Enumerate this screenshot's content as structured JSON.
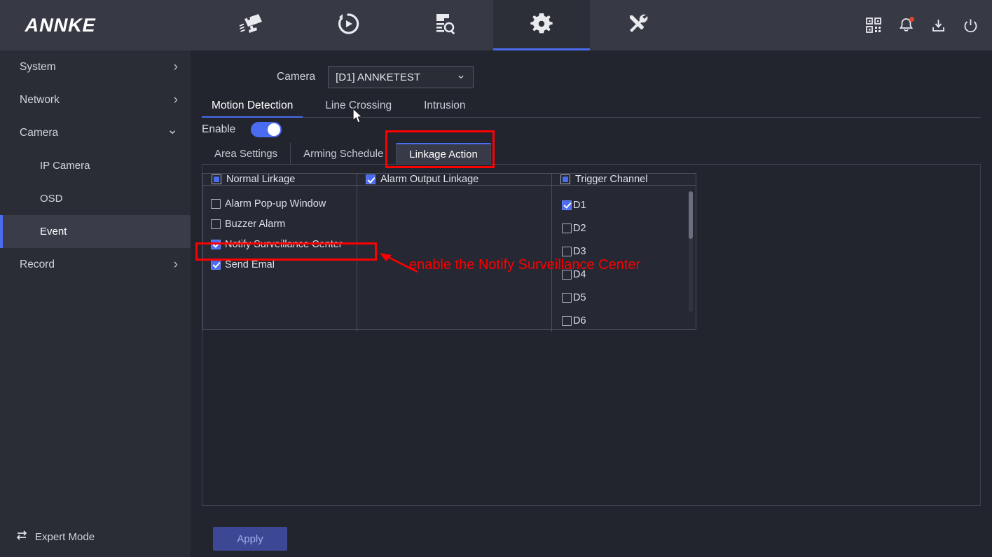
{
  "brand": {
    "name": "ANNKE"
  },
  "topnav": {
    "items": [
      {
        "icon": "camera-icon",
        "name": "live-view",
        "active": false
      },
      {
        "icon": "playback-icon",
        "name": "playback",
        "active": false
      },
      {
        "icon": "log-search-icon",
        "name": "log-search",
        "active": false
      },
      {
        "icon": "gear-icon",
        "name": "configuration",
        "active": true
      },
      {
        "icon": "tools-icon",
        "name": "maintenance",
        "active": false
      }
    ],
    "right_items": [
      {
        "icon": "qr-code-icon",
        "name": "qr-code"
      },
      {
        "icon": "bell-icon",
        "name": "notifications",
        "badge": true
      },
      {
        "icon": "download-icon",
        "name": "download"
      },
      {
        "icon": "power-icon",
        "name": "power"
      }
    ]
  },
  "sidebar": {
    "items": [
      {
        "label": "System",
        "level": "top",
        "chevron": "right",
        "active": false
      },
      {
        "label": "Network",
        "level": "top",
        "chevron": "right",
        "active": false
      },
      {
        "label": "Camera",
        "level": "top",
        "chevron": "down",
        "active": false
      },
      {
        "label": "IP Camera",
        "level": "sub",
        "chevron": "none",
        "active": false
      },
      {
        "label": "OSD",
        "level": "sub",
        "chevron": "none",
        "active": false
      },
      {
        "label": "Event",
        "level": "sub",
        "chevron": "none",
        "active": true
      },
      {
        "label": "Record",
        "level": "top",
        "chevron": "right",
        "active": false
      }
    ],
    "expert_mode_label": "Expert Mode"
  },
  "main": {
    "camera_label": "Camera",
    "camera_value": "[D1] ANNKETEST",
    "main_tabs": [
      {
        "label": "Motion Detection",
        "active": true
      },
      {
        "label": "Line Crossing",
        "active": false
      },
      {
        "label": "Intrusion",
        "active": false
      }
    ],
    "enable_label": "Enable",
    "enable_on": true,
    "sub_tabs": [
      {
        "label": "Area Settings",
        "active": false
      },
      {
        "label": "Arming Schedule",
        "active": false
      },
      {
        "label": "Linkage Action",
        "active": true
      }
    ],
    "linkage": {
      "headers": [
        {
          "label": "Normal Lirkage",
          "state": "partial"
        },
        {
          "label": "Alarm Output Linkage",
          "state": "checked"
        },
        {
          "label": "Trigger Channel",
          "state": "partial"
        }
      ],
      "normal_linkage": [
        {
          "label": "Alarm Pop-up Window",
          "checked": false
        },
        {
          "label": "Buzzer Alarm",
          "checked": false
        },
        {
          "label": "Notify Surveillance Center",
          "checked": true
        },
        {
          "label": "Send Emal",
          "checked": true
        }
      ],
      "alarm_output": [],
      "trigger_channels": [
        {
          "label": "D1",
          "checked": true
        },
        {
          "label": "D2",
          "checked": false
        },
        {
          "label": "D3",
          "checked": false
        },
        {
          "label": "D4",
          "checked": false
        },
        {
          "label": "D5",
          "checked": false
        },
        {
          "label": "D6",
          "checked": false
        }
      ]
    },
    "apply_label": "Apply"
  },
  "annotations": {
    "note_text": "enable the Notify Surveillance Center",
    "color": "#fd0000"
  }
}
